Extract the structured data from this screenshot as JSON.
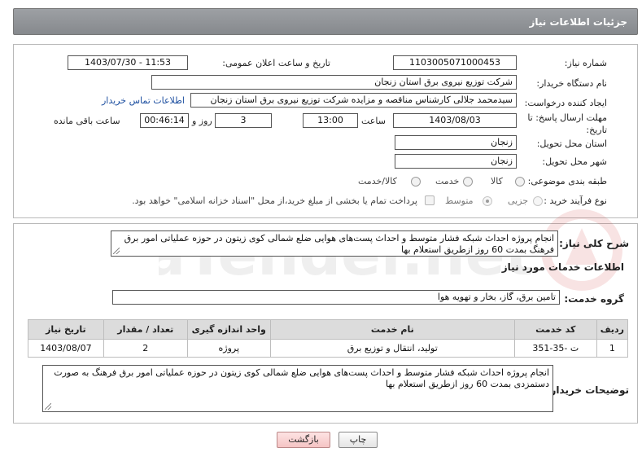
{
  "header": {
    "title": "جزئیات اطلاعات نیاز"
  },
  "form": {
    "need_number_label": "شماره نیاز:",
    "need_number": "1103005071000453",
    "announce_label": "تاریخ و ساعت اعلان عمومی:",
    "announce_value": "1403/07/30 - 11:53",
    "buyer_org_label": "نام دستگاه خریدار:",
    "buyer_org": "شرکت توزیع نیروی برق استان زنجان",
    "creator_label": "ایجاد کننده درخواست:",
    "creator": "سیدمحمد جلالی کارشناس مناقصه و مزایده شرکت توزیع نیروی برق استان زنجان",
    "contact_link": "اطلاعات تماس خریدار",
    "deadline_label": "مهلت ارسال پاسخ: تا تاریخ:",
    "deadline_date": "1403/08/03",
    "time_label": "ساعت",
    "deadline_time": "13:00",
    "days_value": "3",
    "days_label": "روز و",
    "remaining_time": "00:46:14",
    "remaining_label": "ساعت باقی مانده",
    "province_label": "استان محل تحویل:",
    "province": "زنجان",
    "city_label": "شهر محل تحویل:",
    "city": "زنجان",
    "category_label": "طبقه بندی موضوعی:",
    "category_options": [
      "کالا",
      "خدمت",
      "کالا/خدمت"
    ],
    "purchase_type_label": "نوع فرآیند خرید :",
    "purchase_options": [
      "جزیی",
      "متوسط"
    ],
    "treasury_note": "پرداخت تمام یا بخشی از مبلغ خرید،از محل \"اسناد خزانه اسلامی\" خواهد بود."
  },
  "details": {
    "general_desc_label": "شرح کلی نیاز:",
    "general_desc": "انجام پروژه احداث شبکه فشار متوسط و احداث پست‌های هوایی ضلع شمالی کوی زیتون در حوزه عملیاتی امور برق فرهنگ بمدت  60 روز ازطریق استعلام بها",
    "services_heading": "اطلاعات خدمات مورد نیاز",
    "service_group_label": "گروه خدمت:",
    "service_group": "تامین برق، گاز، بخار و تهویه هوا",
    "table": {
      "headers": [
        "ردیف",
        "کد خدمت",
        "نام خدمت",
        "واحد اندازه گیری",
        "تعداد / مقدار",
        "تاریخ نیاز"
      ],
      "rows": [
        [
          "1",
          "ت -35-351",
          "تولید، انتقال و توزیع برق",
          "پروژه",
          "2",
          "1403/08/07"
        ]
      ]
    },
    "buyer_notes_label": "توضیحات خریدار:",
    "buyer_notes": "انجام پروژه احداث شبکه فشار متوسط و احداث پست‌های هوایی ضلع شمالی کوی زیتون در حوزه عملیاتی امور برق فرهنگ به صورت دستمزدی بمدت  60 روز ازطریق استعلام بها"
  },
  "buttons": {
    "print": "چاپ",
    "back": "بازگشت"
  },
  "watermark": {
    "text": "AriaTender.net"
  }
}
